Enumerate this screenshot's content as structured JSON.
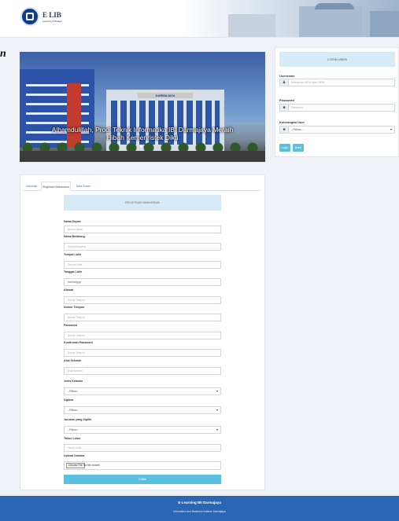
{
  "header": {
    "logo_text": "E LIB",
    "logo_sub": "Learning & Belajar",
    "campus_sign": "IBI DARMAJAYA"
  },
  "stray_text": "n",
  "banner": {
    "building_sign": "DARMAJAYA",
    "caption_line1": "Alhamdulillah, Prodi Teknik Informatika IBI Darmajaya Meraih",
    "caption_line2": "Hibah Kemenristek Dikti"
  },
  "login": {
    "title": "LOGIN USER",
    "username_label": "Username",
    "username_placeholder": "Masukkan NIDN atau NPM",
    "password_label": "Password",
    "password_placeholder": "Password",
    "keterangan_label": "Keterangan User",
    "keterangan_value": "--Pilihan--",
    "login_button": "Login",
    "batal_button": "Batal"
  },
  "tabs": [
    {
      "label": "Informasi"
    },
    {
      "label": "Registrasi Mahasiswa"
    },
    {
      "label": "Data Dosen"
    }
  ],
  "form": {
    "heading": "REGISTRASI MAHASISWA",
    "fields": [
      {
        "label": "Nama Depan",
        "placeholder": "Nama Depan"
      },
      {
        "label": "Nama Belakang",
        "placeholder": "Nama Belakang"
      },
      {
        "label": "Tempat Lahir",
        "placeholder": "Tempat Lahir"
      },
      {
        "label": "Tanggal Lahir",
        "placeholder": "mm/dd/yyyy"
      },
      {
        "label": "Alamat",
        "placeholder": "Nomor Telepon"
      },
      {
        "label": "Nomor Telepon",
        "placeholder": "Nomor Telepon"
      },
      {
        "label": "Password",
        "placeholder": "Nomor Telepon"
      },
      {
        "label": "Konfirmasi Password",
        "placeholder": "Nomor Telepon"
      },
      {
        "label": "Asal Sekolah",
        "placeholder": "Asal Sekolah"
      },
      {
        "label": "Jenis Kelamin",
        "placeholder": "--Pilihan--"
      },
      {
        "label": "Agama",
        "placeholder": "--Pilihan--"
      },
      {
        "label": "Jurusan yang Dipilih",
        "placeholder": "--Pilihan--"
      },
      {
        "label": "Tahun Lulus",
        "placeholder": "Tahun Lulus"
      },
      {
        "label": "Upload Gambar",
        "file_button": "Choose File",
        "file_text": "No file chosen"
      }
    ],
    "submit": "Daftar"
  },
  "footer": {
    "line1": "E-Learning IBI Darmajaya",
    "line2": "Informatics And Business Institute Darmajaya"
  },
  "colors": {
    "accent": "#5bc0de",
    "header_panel": "#d6ebf7",
    "footer": "#2a66b4"
  }
}
